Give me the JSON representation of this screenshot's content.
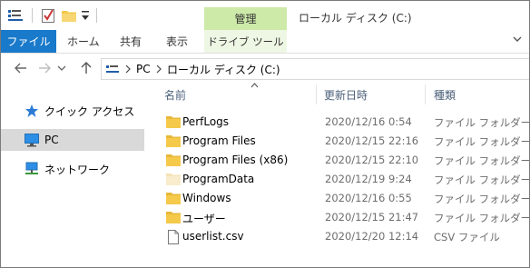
{
  "window": {
    "title": "ローカル ディスク (C:)",
    "manage_tab": "管理"
  },
  "ribbon": {
    "file_tab": "ファイル",
    "tabs": [
      "ホーム",
      "共有",
      "表示"
    ],
    "contextual_tab": "ドライブ ツール",
    "expand_icon": "chevron-down-icon"
  },
  "address": {
    "breadcrumbs": [
      "PC",
      "ローカル ディスク (C:)"
    ]
  },
  "nav": {
    "items": [
      {
        "label": "クイック アクセス",
        "icon": "star-icon",
        "selected": false
      },
      {
        "label": "PC",
        "icon": "computer-icon",
        "selected": true
      },
      {
        "label": "ネットワーク",
        "icon": "network-icon",
        "selected": false
      }
    ]
  },
  "list": {
    "columns": [
      "名前",
      "更新日時",
      "種類"
    ],
    "rows": [
      {
        "name": "PerfLogs",
        "modified": "2020/12/16 0:54",
        "type": "ファイル フォルダー",
        "kind": "folder"
      },
      {
        "name": "Program Files",
        "modified": "2020/12/15 22:16",
        "type": "ファイル フォルダー",
        "kind": "folder"
      },
      {
        "name": "Program Files (x86)",
        "modified": "2020/12/15 22:10",
        "type": "ファイル フォルダー",
        "kind": "folder"
      },
      {
        "name": "ProgramData",
        "modified": "2020/12/19 9:24",
        "type": "ファイル フォルダー",
        "kind": "folder-hidden"
      },
      {
        "name": "Windows",
        "modified": "2020/12/16 0:55",
        "type": "ファイル フォルダー",
        "kind": "folder"
      },
      {
        "name": "ユーザー",
        "modified": "2020/12/15 21:47",
        "type": "ファイル フォルダー",
        "kind": "folder"
      },
      {
        "name": "userlist.csv",
        "modified": "2020/12/20 12:14",
        "type": "CSV ファイル",
        "kind": "file"
      }
    ]
  },
  "colors": {
    "file_tab": "#1979ca",
    "manage_tab": "#cdeaa9",
    "folder": "#f5c94a",
    "selected_nav": "#d9d9d9"
  }
}
